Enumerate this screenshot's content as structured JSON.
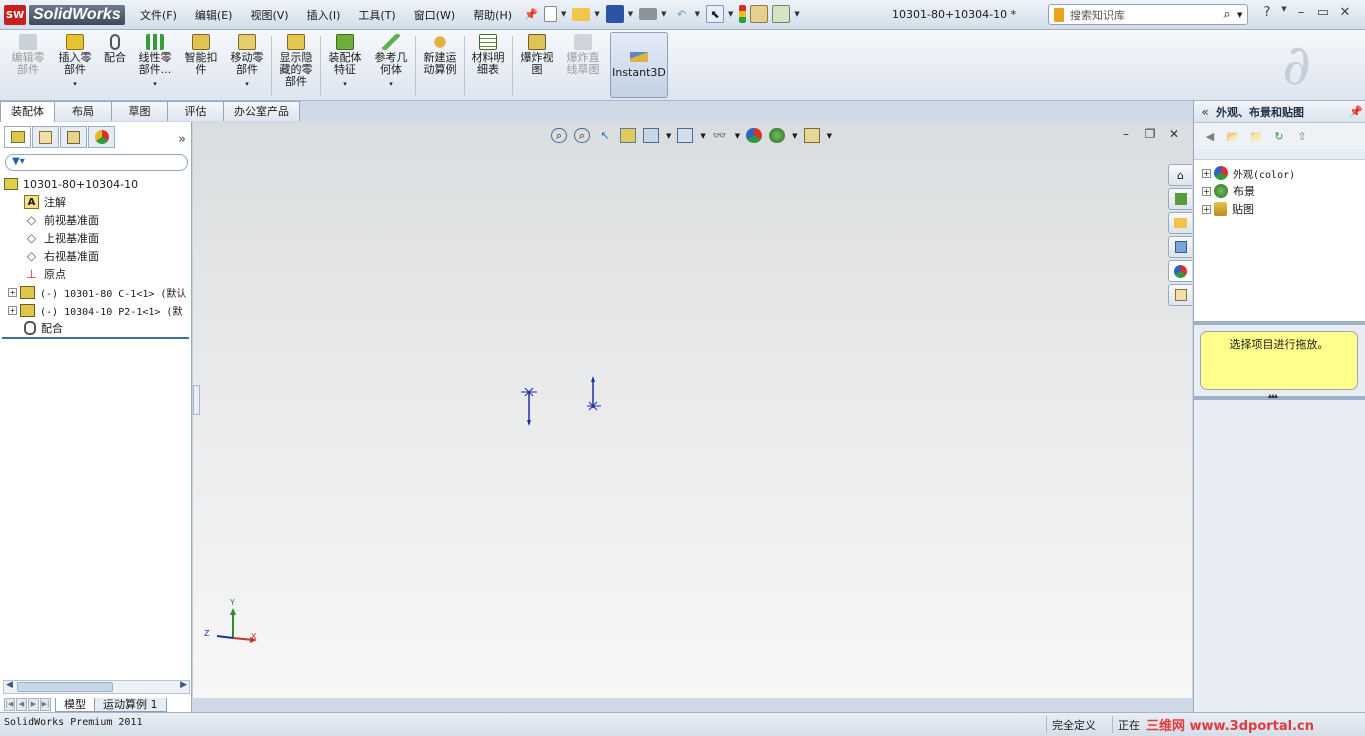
{
  "app": {
    "logo_badge": "SW",
    "name": "SolidWorks",
    "doc_title": "10301-80+10304-10 *"
  },
  "menu": [
    "文件(F)",
    "编辑(E)",
    "视图(V)",
    "插入(I)",
    "工具(T)",
    "窗口(W)",
    "帮助(H)"
  ],
  "search": {
    "placeholder": "搜索知识库"
  },
  "window_buttons": {
    "help": "?",
    "minimize": "–",
    "restore": "▭",
    "close": "✕"
  },
  "toolbar": {
    "edit_part": "编辑零\n部件",
    "insert_part": "插入零\n部件",
    "mate": "配合",
    "linear_pattern": "线性零\n部件...",
    "smart_fasteners": "智能扣\n件",
    "move_part": "移动零\n部件",
    "show_hidden": "显示隐\n藏的零\n部件",
    "assembly_features": "装配体\n特征",
    "reference_geometry": "参考几\n何体",
    "new_motion_study": "新建运\n动算例",
    "bom": "材料明\n细表",
    "exploded_view": "爆炸视\n图",
    "explode_line_sketch": "爆炸直\n线草图",
    "instant3d": "Instant3D",
    "drop_arrow": "▾"
  },
  "tabs": [
    "装配体",
    "布局",
    "草图",
    "评估",
    "办公室产品"
  ],
  "feature_tree": {
    "root": "10301-80+10304-10",
    "items": [
      {
        "label": "注解"
      },
      {
        "label": "前视基准面"
      },
      {
        "label": "上视基准面"
      },
      {
        "label": "右视基准面"
      },
      {
        "label": "原点"
      },
      {
        "label": "(-) 10301-80 C-1<1> (默认"
      },
      {
        "label": "(-) 10304-10 P2-1<1> (默"
      },
      {
        "label": "配合"
      }
    ]
  },
  "bottom_tabs": [
    "模型",
    "运动算例 1"
  ],
  "viewport": {
    "triad": {
      "x": "X",
      "y": "Y",
      "z": "Z"
    }
  },
  "task_pane": {
    "title": "外观、布景和贴图",
    "items": [
      "外观(color)",
      "布景",
      "贴图"
    ],
    "note": "选择项目进行拖放。"
  },
  "status": {
    "product": "SolidWorks Premium 2011",
    "definition": "完全定义",
    "editing": "正在",
    "watermark": "三维网 www.3dportal.cn"
  },
  "colors": {
    "accent": "#3a6fb0",
    "note_bg": "#ffff8c",
    "logo_red": "#c8201e"
  }
}
